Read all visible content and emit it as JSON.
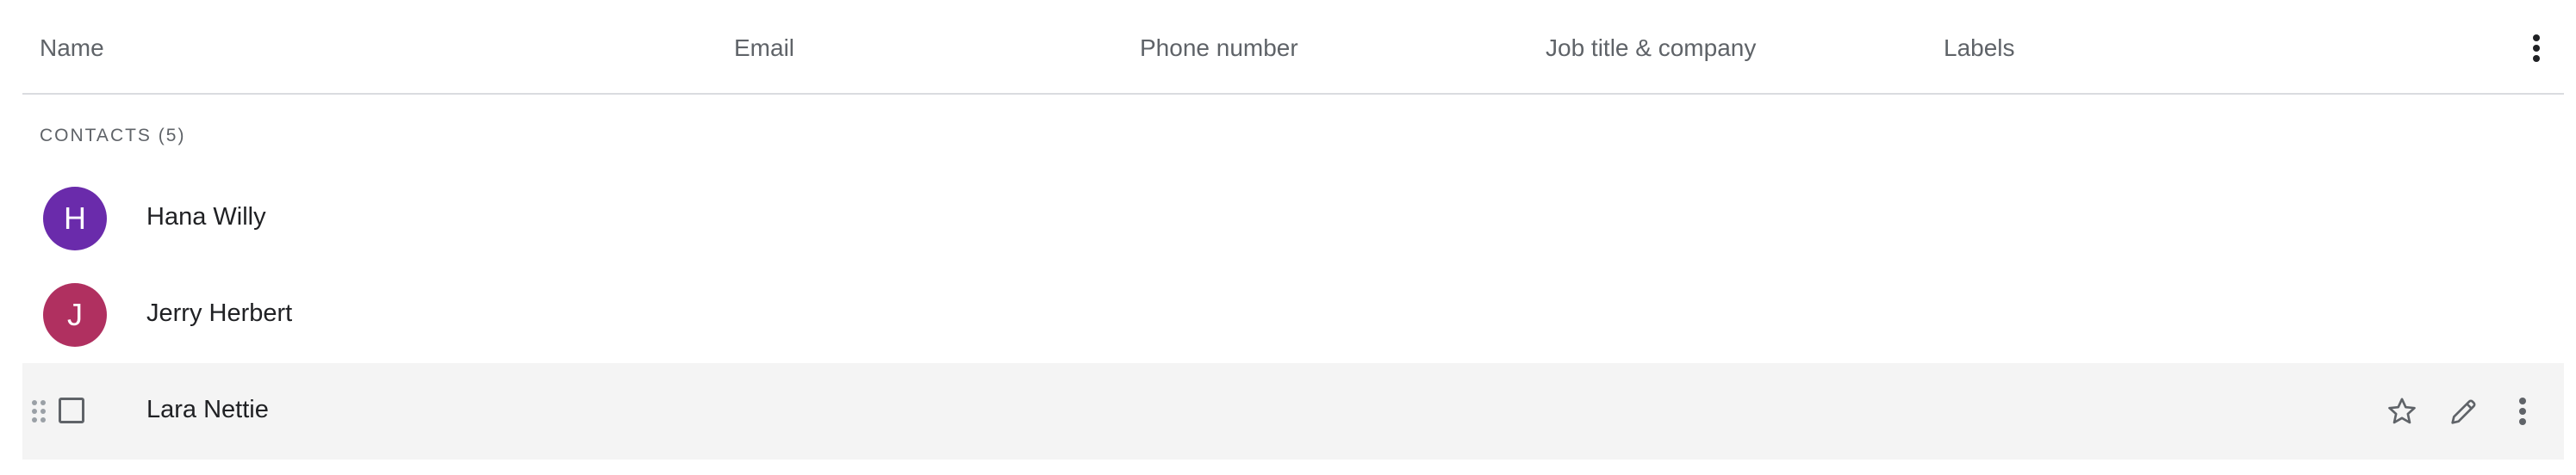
{
  "columns": {
    "name": "Name",
    "email": "Email",
    "phone": "Phone number",
    "job": "Job title & company",
    "labels": "Labels"
  },
  "section": {
    "label": "CONTACTS (5)"
  },
  "contacts": [
    {
      "initial": "H",
      "name": "Hana Willy",
      "avatar_color": "#6a2bab"
    },
    {
      "initial": "J",
      "name": "Jerry Herbert",
      "avatar_color": "#b03060"
    },
    {
      "name": "Lara Nettie"
    }
  ],
  "icons": {
    "header_more": "more-vert-icon",
    "drag": "drag-handle-icon",
    "checkbox": "checkbox-icon",
    "star": "star-outline-icon",
    "edit": "edit-pencil-icon",
    "row_more": "more-vert-icon"
  }
}
